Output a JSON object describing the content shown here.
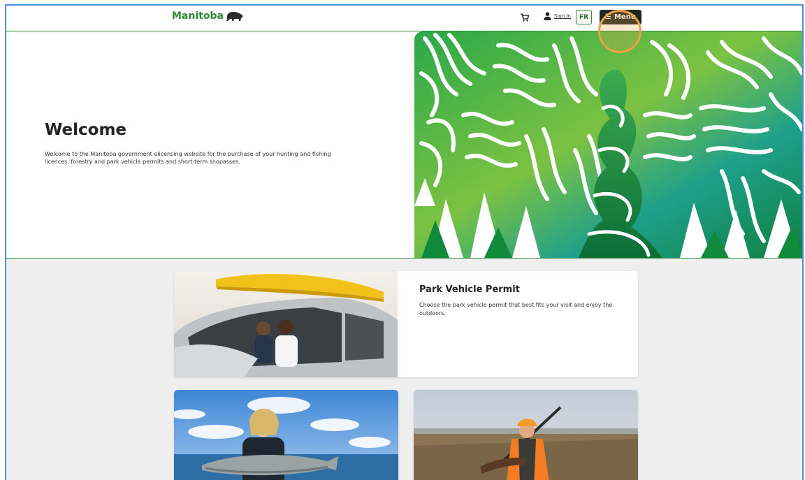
{
  "header": {
    "logo_text": "Manitoba",
    "logo_icon": "bison-icon",
    "cart_icon": "cart-icon",
    "signin_label": "Sign In",
    "lang_toggle": "FR",
    "menu_label": "Menu",
    "menu_icon": "hamburger-icon"
  },
  "hero": {
    "title": "Welcome",
    "body": "Welcome to the Manitoba government elicensing website for the purchase of your hunting and fishing licences, forestry and park vehicle permits and short-term snopasses."
  },
  "cards": {
    "park": {
      "title": "Park Vehicle Permit",
      "description": "Choose the park vehicle permit that best fits your visit and enjoy the outdoors."
    }
  },
  "colors": {
    "brand_green": "#2e8b3a",
    "menu_bg": "#1f2a1f",
    "highlight": "#f0a04b",
    "page_bg": "#efefef"
  }
}
